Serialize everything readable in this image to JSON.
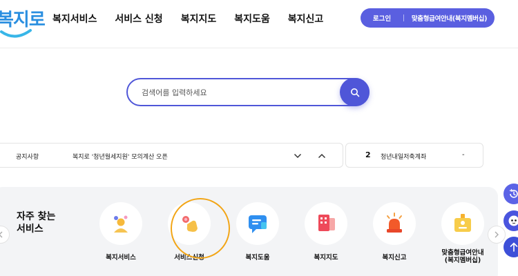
{
  "header": {
    "logo_text": "복지로",
    "nav": [
      "복지서비스",
      "서비스 신청",
      "복지지도",
      "복지도움",
      "복지신고"
    ],
    "login_label": "로그인",
    "benefit_info_label": "맞춤형급여안내(복지멤버십)"
  },
  "search": {
    "placeholder": "검색어를 입력하세요",
    "value": ""
  },
  "notice": {
    "category": "공지사항",
    "title": "복지로 '청년월세지원' 모의계산 오픈"
  },
  "rank": {
    "number": "2",
    "text": "청년내일저축계좌",
    "change": "-"
  },
  "frequent": {
    "title": "자주 찾는 서비스",
    "items": [
      {
        "label": "복지서비스",
        "icon": "person-icon"
      },
      {
        "label": "서비스신청",
        "icon": "hand-click-icon"
      },
      {
        "label": "복지도움",
        "icon": "chat-icon"
      },
      {
        "label": "복지지도",
        "icon": "map-icon"
      },
      {
        "label": "복지신고",
        "icon": "alarm-icon"
      },
      {
        "label": "맞춤형급여안내(복지멤버십)",
        "label_line1": "맞춤형급여안내",
        "label_line2": "(복지멤버십)",
        "icon": "badge-icon"
      }
    ]
  },
  "colors": {
    "accent": "#5a5fe0",
    "highlight": "#f2a516",
    "panel": "#f3f4f6"
  }
}
